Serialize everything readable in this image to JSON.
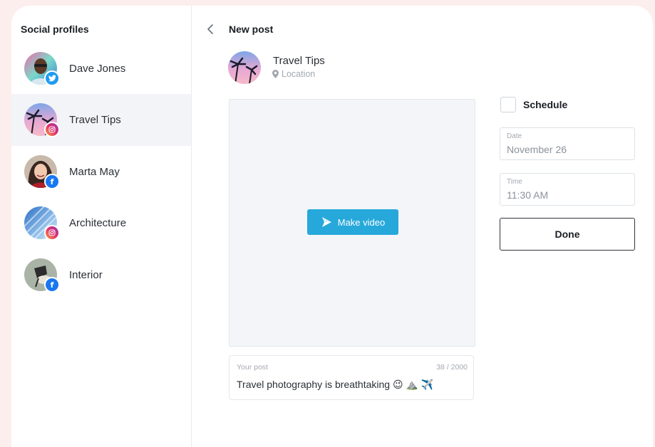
{
  "sidebar": {
    "title": "Social profiles",
    "profiles": [
      {
        "name": "Dave Jones",
        "network": "twitter"
      },
      {
        "name": "Travel Tips",
        "network": "instagram",
        "active": true
      },
      {
        "name": "Marta May",
        "network": "facebook"
      },
      {
        "name": "Architecture",
        "network": "instagram"
      },
      {
        "name": "Interior",
        "network": "facebook"
      }
    ]
  },
  "header": {
    "title": "New post",
    "back_icon": "chevron-left-icon"
  },
  "post": {
    "account": "Travel Tips",
    "location_placeholder": "Location",
    "make_video_label": "Make video",
    "field_label": "Your post",
    "char_count": "38 / 2000",
    "text": "Travel photography is breathtaking 😉 ⛰️ ✈️"
  },
  "schedule": {
    "label": "Schedule",
    "checked": false,
    "date_label": "Date",
    "date_value": "November 26",
    "time_label": "Time",
    "time_value": "11:30 AM",
    "done_label": "Done"
  },
  "colors": {
    "accent": "#27a8db",
    "twitter": "#1d9bf0",
    "facebook": "#1877f2",
    "active_row": "#f2f4f7",
    "page_bg": "#fdeeee"
  }
}
